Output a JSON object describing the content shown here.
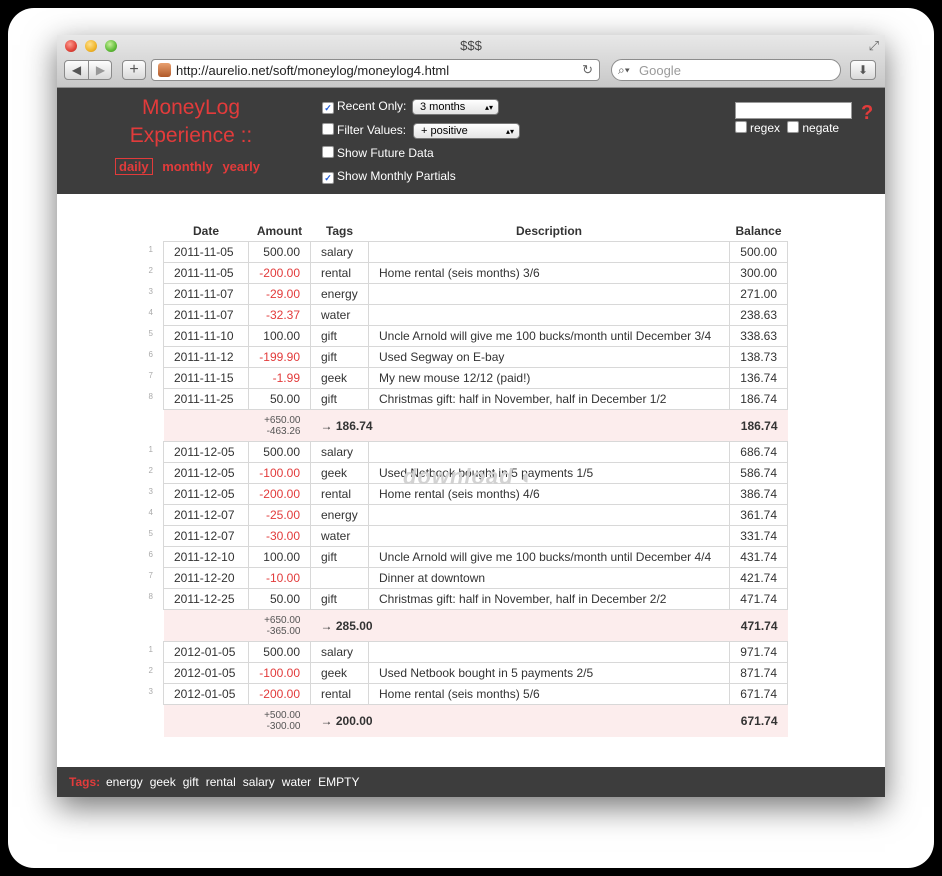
{
  "window": {
    "title": "$$$"
  },
  "toolbar": {
    "back_icon": "◀",
    "forward_icon": "▶",
    "plus_label": "+",
    "url": "http://aurelio.net/soft/moneylog/moneylog4.html",
    "search_placeholder": "Google"
  },
  "brand": {
    "line1": "MoneyLog",
    "line2": "Experience ::"
  },
  "views": {
    "daily": "daily",
    "monthly": "monthly",
    "yearly": "yearly"
  },
  "options": {
    "recent_only": {
      "label": "Recent Only:",
      "checked": true,
      "value": "3 months"
    },
    "filter_values": {
      "label": "Filter Values:",
      "checked": false,
      "value": "+ positive"
    },
    "show_future": {
      "label": "Show Future Data",
      "checked": false
    },
    "show_partials": {
      "label": "Show Monthly Partials",
      "checked": true
    }
  },
  "filter": {
    "regex_label": "regex",
    "negate_label": "negate",
    "help": "?"
  },
  "table": {
    "headers": {
      "date": "Date",
      "amount": "Amount",
      "tags": "Tags",
      "description": "Description",
      "balance": "Balance"
    },
    "months": [
      {
        "rows": [
          {
            "n": "1",
            "date": "2011-11-05",
            "amount": "500.00",
            "tags": "salary",
            "desc": "",
            "balance": "500.00"
          },
          {
            "n": "2",
            "date": "2011-11-05",
            "amount": "-200.00",
            "tags": "rental",
            "desc": "Home rental (seis months) 3/6",
            "balance": "300.00"
          },
          {
            "n": "3",
            "date": "2011-11-07",
            "amount": "-29.00",
            "tags": "energy",
            "desc": "",
            "balance": "271.00"
          },
          {
            "n": "4",
            "date": "2011-11-07",
            "amount": "-32.37",
            "tags": "water",
            "desc": "",
            "balance": "238.63"
          },
          {
            "n": "5",
            "date": "2011-11-10",
            "amount": "100.00",
            "tags": "gift",
            "desc": "Uncle Arnold will give me 100 bucks/month until December 3/4",
            "balance": "338.63"
          },
          {
            "n": "6",
            "date": "2011-11-12",
            "amount": "-199.90",
            "tags": "gift",
            "desc": "Used Segway on E-bay",
            "balance": "138.73"
          },
          {
            "n": "7",
            "date": "2011-11-15",
            "amount": "-1.99",
            "tags": "geek",
            "desc": "My new mouse 12/12 (paid!)",
            "balance": "136.74"
          },
          {
            "n": "8",
            "date": "2011-11-25",
            "amount": "50.00",
            "tags": "gift",
            "desc": "Christmas gift: half in November, half in December 1/2",
            "balance": "186.74"
          }
        ],
        "total": {
          "plus": "+650.00",
          "minus": "-463.26",
          "result": "186.74",
          "balance": "186.74"
        }
      },
      {
        "rows": [
          {
            "n": "1",
            "date": "2011-12-05",
            "amount": "500.00",
            "tags": "salary",
            "desc": "",
            "balance": "686.74"
          },
          {
            "n": "2",
            "date": "2011-12-05",
            "amount": "-100.00",
            "tags": "geek",
            "desc": "Used Netbook bought in 5 payments 1/5",
            "balance": "586.74"
          },
          {
            "n": "3",
            "date": "2011-12-05",
            "amount": "-200.00",
            "tags": "rental",
            "desc": "Home rental (seis months) 4/6",
            "balance": "386.74"
          },
          {
            "n": "4",
            "date": "2011-12-07",
            "amount": "-25.00",
            "tags": "energy",
            "desc": "",
            "balance": "361.74"
          },
          {
            "n": "5",
            "date": "2011-12-07",
            "amount": "-30.00",
            "tags": "water",
            "desc": "",
            "balance": "331.74"
          },
          {
            "n": "6",
            "date": "2011-12-10",
            "amount": "100.00",
            "tags": "gift",
            "desc": "Uncle Arnold will give me 100 bucks/month until December 4/4",
            "balance": "431.74"
          },
          {
            "n": "7",
            "date": "2011-12-20",
            "amount": "-10.00",
            "tags": "",
            "desc": "Dinner at downtown",
            "balance": "421.74"
          },
          {
            "n": "8",
            "date": "2011-12-25",
            "amount": "50.00",
            "tags": "gift",
            "desc": "Christmas gift: half in November, half in December 2/2",
            "balance": "471.74"
          }
        ],
        "total": {
          "plus": "+650.00",
          "minus": "-365.00",
          "result": "285.00",
          "balance": "471.74"
        }
      },
      {
        "rows": [
          {
            "n": "1",
            "date": "2012-01-05",
            "amount": "500.00",
            "tags": "salary",
            "desc": "",
            "balance": "971.74"
          },
          {
            "n": "2",
            "date": "2012-01-05",
            "amount": "-100.00",
            "tags": "geek",
            "desc": "Used Netbook bought in 5 payments 2/5",
            "balance": "871.74"
          },
          {
            "n": "3",
            "date": "2012-01-05",
            "amount": "-200.00",
            "tags": "rental",
            "desc": "Home rental (seis months) 5/6",
            "balance": "671.74"
          }
        ],
        "total": {
          "plus": "+500.00",
          "minus": "-300.00",
          "result": "200.00",
          "balance": "671.74"
        }
      }
    ]
  },
  "watermark": "download",
  "footer": {
    "label": "Tags:",
    "tags": [
      "energy",
      "geek",
      "gift",
      "rental",
      "salary",
      "water",
      "EMPTY"
    ]
  },
  "colors": {
    "accent": "#e23b3b",
    "header_bg": "#3d3d3d",
    "total_bg": "#fceded"
  }
}
